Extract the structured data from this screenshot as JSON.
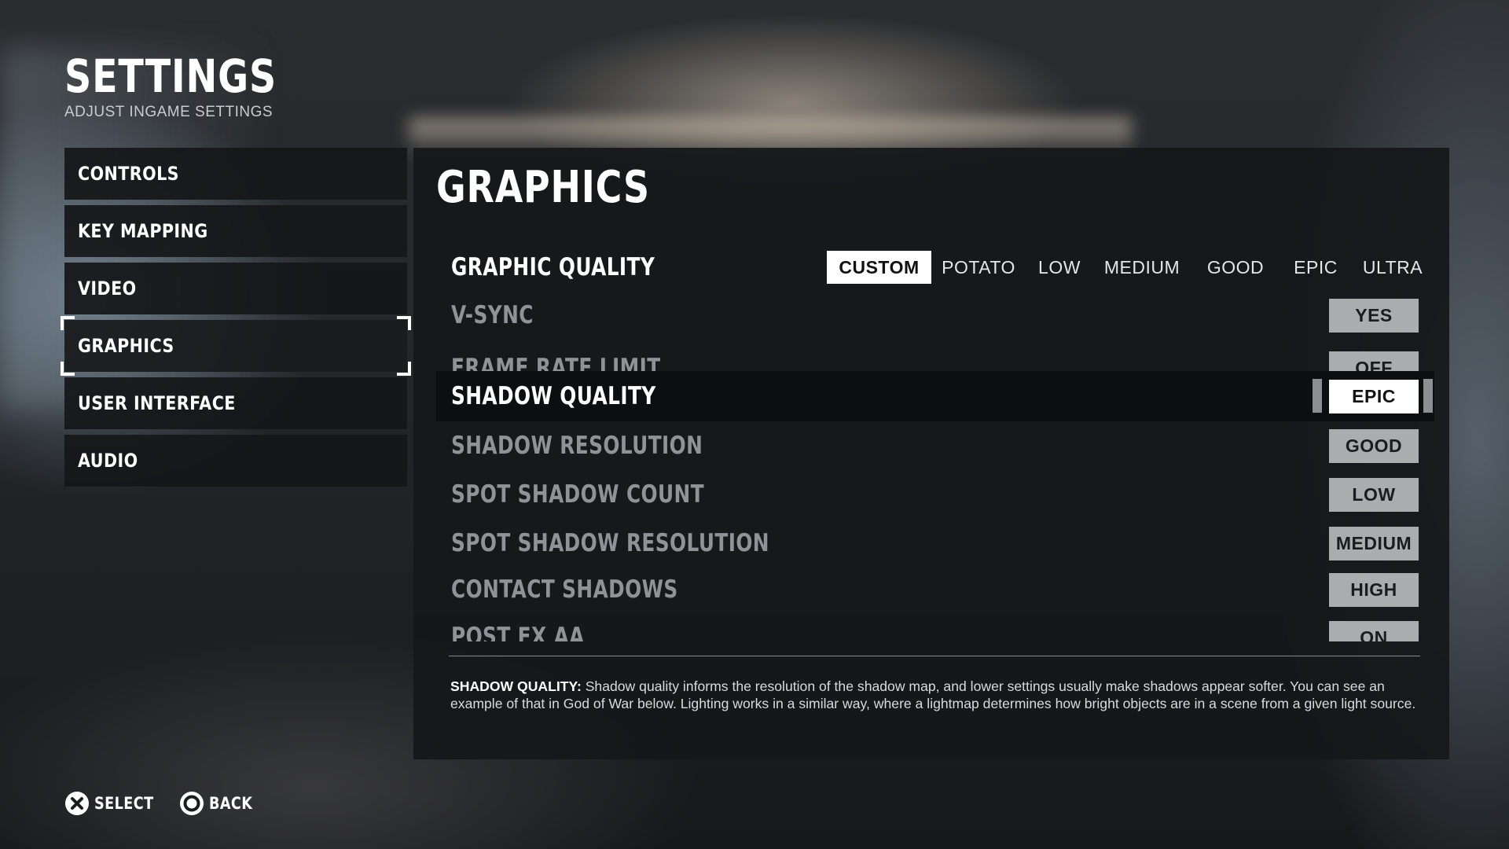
{
  "header": {
    "title": "SETTINGS",
    "subtitle": "ADJUST INGAME SETTINGS"
  },
  "sidebar": {
    "items": [
      {
        "label": "CONTROLS"
      },
      {
        "label": "KEY MAPPING"
      },
      {
        "label": "VIDEO"
      },
      {
        "label": "GRAPHICS",
        "active": true
      },
      {
        "label": "USER INTERFACE"
      },
      {
        "label": "AUDIO"
      }
    ]
  },
  "panel": {
    "title": "GRAPHICS",
    "graphic_quality": {
      "label": "GRAPHIC QUALITY",
      "options": [
        "CUSTOM",
        "POTATO",
        "LOW",
        "MEDIUM",
        "GOOD",
        "EPIC",
        "ULTRA"
      ],
      "selected": "CUSTOM"
    },
    "settings": [
      {
        "label": "V-SYNC",
        "value": "YES"
      },
      {
        "label": "FRAME RATE LIMIT",
        "value": "OFF"
      },
      {
        "label": "SHADOW QUALITY",
        "value": "EPIC",
        "focused": true
      },
      {
        "label": "SHADOW RESOLUTION",
        "value": "GOOD"
      },
      {
        "label": "SPOT SHADOW COUNT",
        "value": "LOW"
      },
      {
        "label": "SPOT SHADOW RESOLUTION",
        "value": "MEDIUM"
      },
      {
        "label": "CONTACT SHADOWS",
        "value": "HIGH"
      },
      {
        "label": "POST FX AA",
        "value": "ON"
      }
    ],
    "description": {
      "heading": "SHADOW QUALITY:",
      "text": "Shadow quality informs the resolution of the shadow map, and lower settings usually make shadows appear softer. You can see an example of that in God of War below. Lighting works in a similar way, where a lightmap determines how bright objects are in a scene from a given light source."
    }
  },
  "footer": {
    "hints": [
      {
        "icon": "cross-button-icon",
        "label": "SELECT"
      },
      {
        "icon": "circle-button-icon",
        "label": "BACK"
      }
    ]
  },
  "colors": {
    "panel_bg": "#16171a",
    "value_bg": "#aaacae",
    "selected_bg": "#ffffff",
    "dim_label": "#8f9296"
  }
}
